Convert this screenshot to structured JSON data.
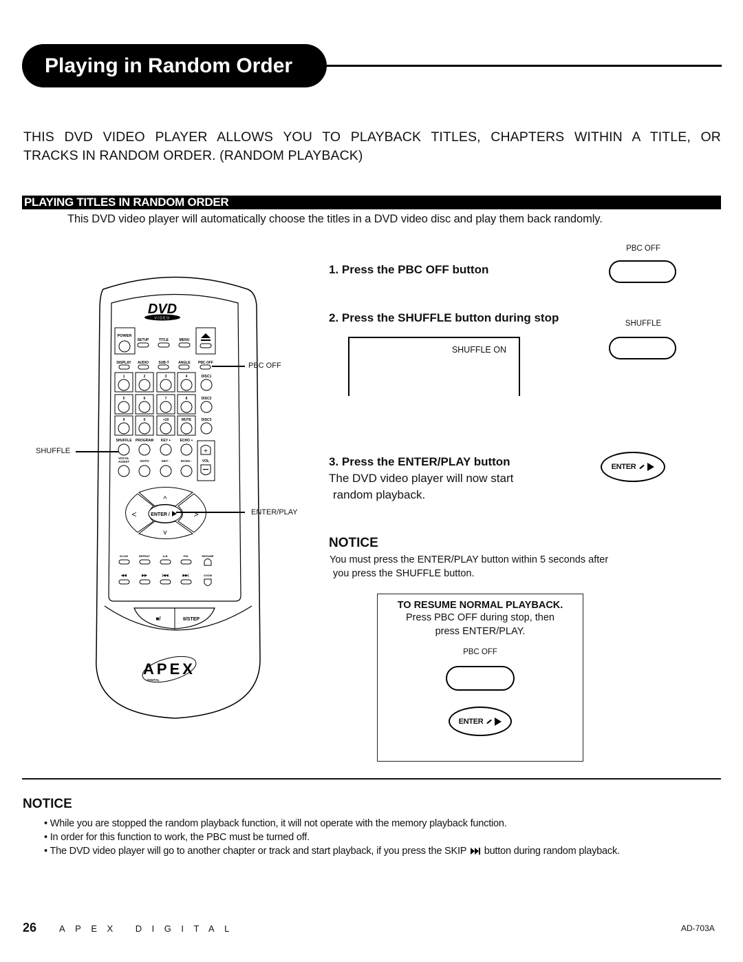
{
  "header": {
    "title": "Playing in Random Order"
  },
  "intro": {
    "line1": "THIS DVD VIDEO PLAYER ALLOWS YOU TO PLAYBACK TITLES, CHAPTERS WITHIN A TITLE, OR",
    "line2": "TRACKS IN RANDOM ORDER.  (RANDOM PLAYBACK)"
  },
  "section": {
    "heading": "PLAYING TITLES IN RANDOM ORDER",
    "description": "This DVD video player will automatically choose the titles in a DVD video disc and play them back randomly."
  },
  "remote": {
    "brand_logo": "DVD",
    "brand_sub": "VIDEO",
    "maker": "APEX",
    "maker_sub": "DIGITAL",
    "row_top": [
      "POWER",
      "SETUP",
      "TITLE",
      "MENU"
    ],
    "row_func": [
      "DISPLAY",
      "AUDIO",
      "SUB-T",
      "ANGLE",
      "PBC OFF"
    ],
    "num_rows": [
      [
        "1",
        "2",
        "3",
        "4",
        "DISC1"
      ],
      [
        "5",
        "6",
        "7",
        "8",
        "DISC2"
      ],
      [
        "9",
        "0",
        "+10",
        "MUTE",
        "DISC3"
      ]
    ],
    "row_shuffle": [
      "SHUFFLE",
      "PROGRAM",
      "KEY +",
      "ECHO +"
    ],
    "row_vocal": [
      "VOCAL",
      "ASSIST",
      "GOTO",
      "KEY -",
      "ECHO -"
    ],
    "vol_label": "VOL",
    "enter_label": "ENTER /",
    "row_slow": [
      "SLOW",
      "REPEAT",
      "A-B",
      "P/N",
      "RESUME"
    ],
    "row_skip_last": "ZOOM",
    "stop_label": "■/",
    "pause_label": "II/STEP",
    "callouts": {
      "pbc_off": "PBC OFF",
      "shuffle": "SHUFFLE",
      "enter_play": "ENTER/PLAY"
    }
  },
  "steps": [
    {
      "heading": "1. Press the PBC OFF button",
      "button_caption": "PBC OFF"
    },
    {
      "heading": "2. Press the SHUFFLE button during stop",
      "button_caption": "SHUFFLE",
      "osd_text": "SHUFFLE ON"
    },
    {
      "heading": "3. Press the ENTER/PLAY button",
      "body_line1": "The DVD video player will now start",
      "body_line2": "random playback.",
      "button_label": "ENTER"
    }
  ],
  "notice_inline": {
    "heading": "NOTICE",
    "line1": "You must press the ENTER/PLAY button within 5 seconds after",
    "line2": "you press the SHUFFLE button."
  },
  "resume_box": {
    "heading": "TO RESUME NORMAL PLAYBACK.",
    "line1": "Press PBC OFF during stop, then",
    "line2": "press ENTER/PLAY.",
    "button_caption": "PBC OFF",
    "enter_label": "ENTER"
  },
  "notice_bottom": {
    "heading": "NOTICE",
    "bullets": [
      "While you are stopped the random playback function, it will not operate with the memory playback function.",
      "In order for this function to work, the PBC must be turned off.",
      "The DVD video player will go to another chapter or track and start playback, if you press the SKIP",
      "button during random playback."
    ]
  },
  "footer": {
    "page_number": "26",
    "brand": "APEX DIGITAL",
    "model": "AD-703A"
  }
}
